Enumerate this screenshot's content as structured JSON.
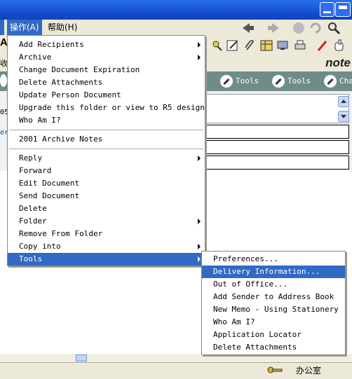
{
  "menubar": {
    "items": [
      {
        "label": "操作(A)"
      },
      {
        "label": "帮助(H)"
      }
    ]
  },
  "toolbar": {
    "app_label_fragment": "note"
  },
  "action_bar": {
    "buttons": [
      {
        "label": "Tools"
      },
      {
        "label": "Tools"
      },
      {
        "label": "Cha"
      }
    ]
  },
  "background_fragments": {
    "left_letter": "A",
    "left_text_1": "收",
    "left_text_2": "05",
    "left_text_3": "er"
  },
  "action_menu": {
    "groups": [
      [
        {
          "label": "Add Recipients",
          "has_submenu": true
        },
        {
          "label": "Archive",
          "has_submenu": true
        },
        {
          "label": "Change Document Expiration",
          "has_submenu": false
        },
        {
          "label": "Delete Attachments",
          "has_submenu": false
        },
        {
          "label": "Update Person Document",
          "has_submenu": false
        },
        {
          "label": "Upgrade this folder or view to R5 design",
          "has_submenu": false
        },
        {
          "label": "Who Am I?",
          "has_submenu": false
        }
      ],
      [
        {
          "label": "2001 Archive Notes",
          "has_submenu": false
        }
      ],
      [
        {
          "label": "Reply",
          "has_submenu": true
        },
        {
          "label": "Forward",
          "has_submenu": false
        },
        {
          "label": "Edit Document",
          "has_submenu": false
        },
        {
          "label": "Send Document",
          "has_submenu": false
        },
        {
          "label": "Delete",
          "has_submenu": false
        },
        {
          "label": "Folder",
          "has_submenu": true
        },
        {
          "label": "Remove From Folder",
          "has_submenu": false
        },
        {
          "label": "Copy into",
          "has_submenu": true
        },
        {
          "label": "Tools",
          "has_submenu": true,
          "highlighted": true
        }
      ]
    ]
  },
  "tools_submenu": {
    "items": [
      {
        "label": "Preferences..."
      },
      {
        "label": "Delivery Information...",
        "highlighted": true
      },
      {
        "label": "Out of Office..."
      },
      {
        "label": "Add Sender to Address Book"
      },
      {
        "label": "New Memo - Using Stationery"
      },
      {
        "label": "Who Am I?"
      },
      {
        "label": "Application Locator"
      },
      {
        "label": "Delete Attachments"
      }
    ]
  },
  "statusbar": {
    "location": "办公室"
  },
  "colors": {
    "titlebar": "#1550d0",
    "menu_highlight": "#316ac5",
    "action_bar": "#6f8c8a",
    "chrome": "#ece9d8"
  }
}
